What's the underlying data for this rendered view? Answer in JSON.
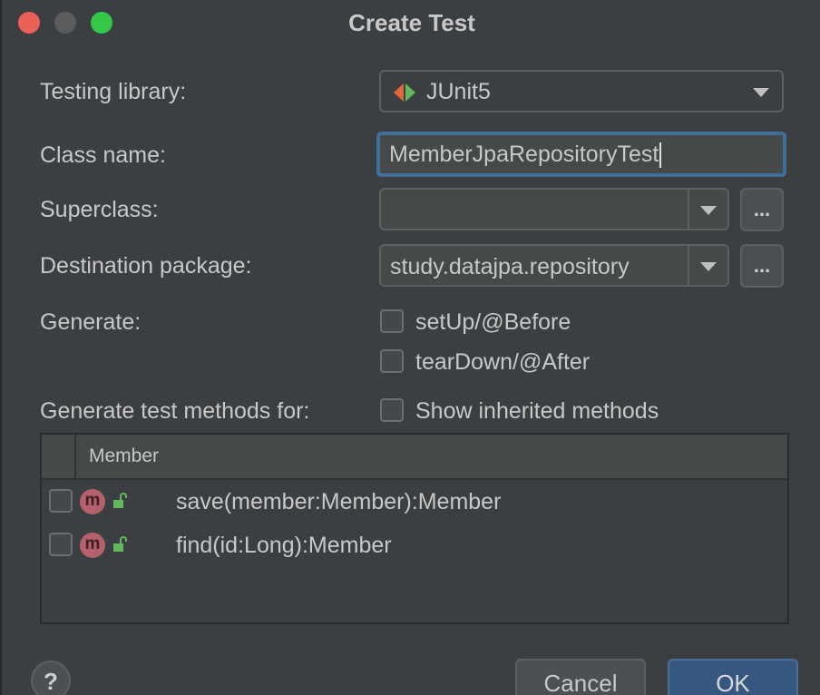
{
  "window": {
    "title": "Create Test"
  },
  "form": {
    "testing_library": {
      "label": "Testing library:",
      "value": "JUnit5"
    },
    "class_name": {
      "label": "Class name:",
      "value": "MemberJpaRepositoryTest"
    },
    "superclass": {
      "label": "Superclass:",
      "value": "",
      "browse": "..."
    },
    "destination_package": {
      "label": "Destination package:",
      "value": "study.datajpa.repository",
      "browse": "..."
    },
    "generate": {
      "label": "Generate:",
      "setup": "setUp/@Before",
      "teardown": "tearDown/@After"
    },
    "methods_for": {
      "label": "Generate test methods for:",
      "show_inherited": "Show inherited methods"
    }
  },
  "table": {
    "header": "Member",
    "rows": [
      {
        "icon": "m",
        "signature": "save(member:Member):Member"
      },
      {
        "icon": "m",
        "signature": "find(id:Long):Member"
      }
    ]
  },
  "footer": {
    "help": "?",
    "cancel": "Cancel",
    "ok": "OK"
  },
  "colors": {
    "accent": "#365880",
    "method_icon": "#b6606c",
    "lock_icon": "#5fb85c"
  }
}
